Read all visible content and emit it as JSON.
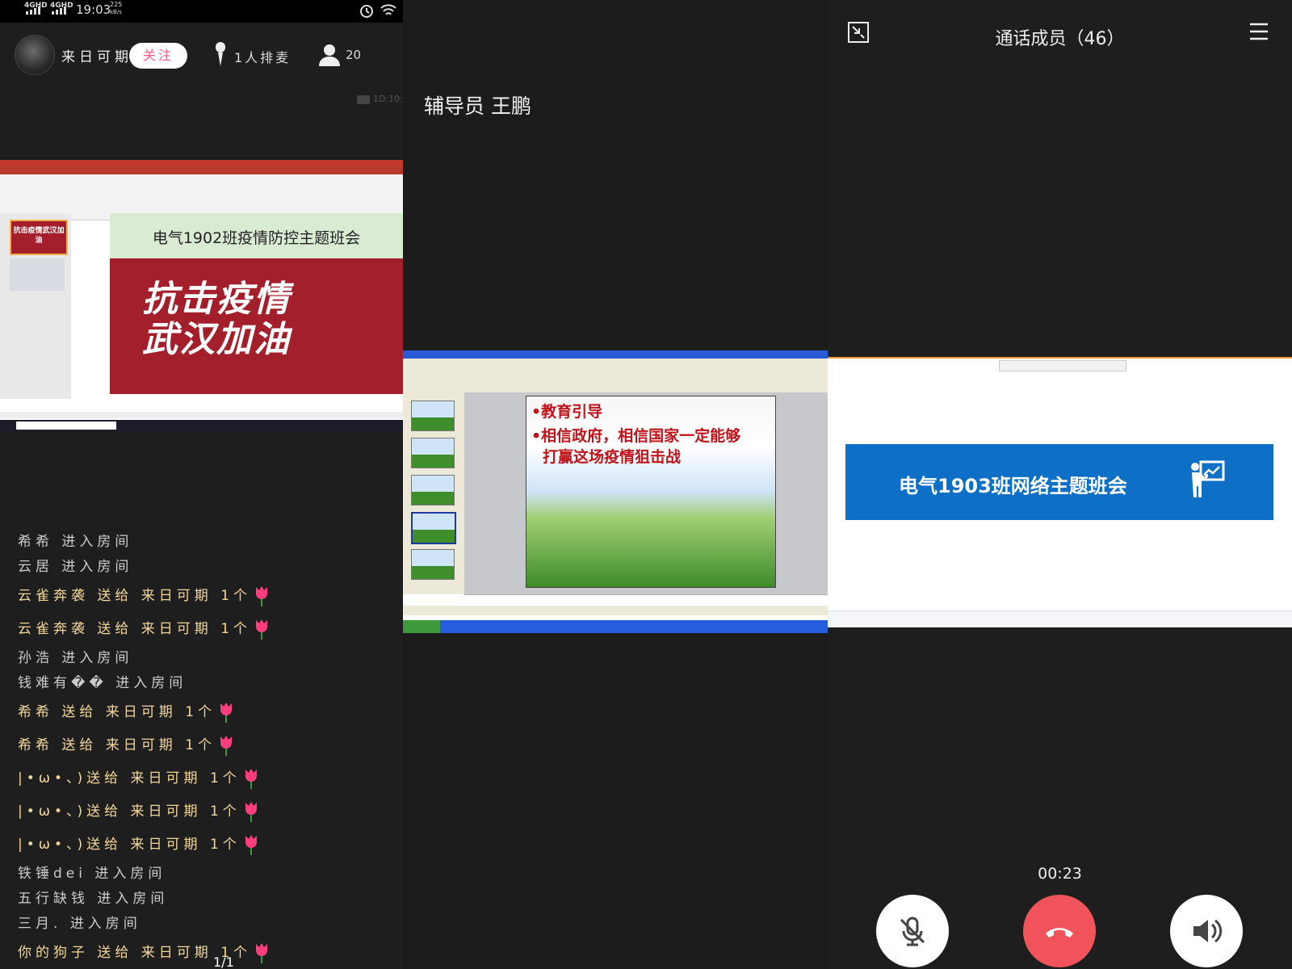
{
  "left_panel": {
    "status": {
      "net1": "4GHD",
      "net2": "4GHD",
      "time": "19:03",
      "speed": "225",
      "speed_unit": "kB/s"
    },
    "host": {
      "name": "来日可期",
      "follow_label": "关注",
      "queue": "1人排麦",
      "viewer_count": "20"
    },
    "record_timer": "1D:10:",
    "screen_share": {
      "slide_title": "电气1902班疫情防控主题班会",
      "slogan_line1": "抗击疫情",
      "slogan_line2": "武汉加油",
      "thumb_text": "抗击疫情武汉加油"
    },
    "chat": [
      {
        "text": "希希 进入房间",
        "gift": false
      },
      {
        "text": "云居 进入房间",
        "gift": false
      },
      {
        "text": "云雀奔袭 送给 来日可期 1个",
        "gift": true
      },
      {
        "text": "云雀奔袭 送给 来日可期 1个",
        "gift": true
      },
      {
        "text": "孙浩 进入房间",
        "gift": false
      },
      {
        "text": "钱难有�� 进入房间",
        "gift": false
      },
      {
        "text": "希希 送给 来日可期 1个",
        "gift": true
      },
      {
        "text": "希希 送给 来日可期 1个",
        "gift": true
      },
      {
        "text": "|•ω•、)送给 来日可期 1个",
        "gift": true
      },
      {
        "text": "|•ω•、)送给 来日可期 1个",
        "gift": true
      },
      {
        "text": "|•ω•、)送给 来日可期 1个",
        "gift": true
      },
      {
        "text": "铁锤dei 进入房间",
        "gift": false
      },
      {
        "text": "五行缺钱 进入房间",
        "gift": false
      },
      {
        "text": "三月. 进入房间",
        "gift": false
      },
      {
        "text": "你的狗子 送给 来日可期 1个",
        "gift": true
      }
    ],
    "page_indicator": "1/1"
  },
  "middle_panel": {
    "counselor": "辅导员 王鹏",
    "slide": {
      "bullet1": "•教育引导",
      "bullet2": "•相信政府，相信国家一定能够",
      "bullet2b": "打赢这场疫情狙击战"
    }
  },
  "right_panel": {
    "members_title": "通话成员（46）",
    "banner_title": "电气1903班网络主题班会",
    "call_timer": "00:23"
  },
  "colors": {
    "accent_red": "#f2545b",
    "banner_blue": "#0d6fc5",
    "follow_pink": "#ff5a8a"
  }
}
